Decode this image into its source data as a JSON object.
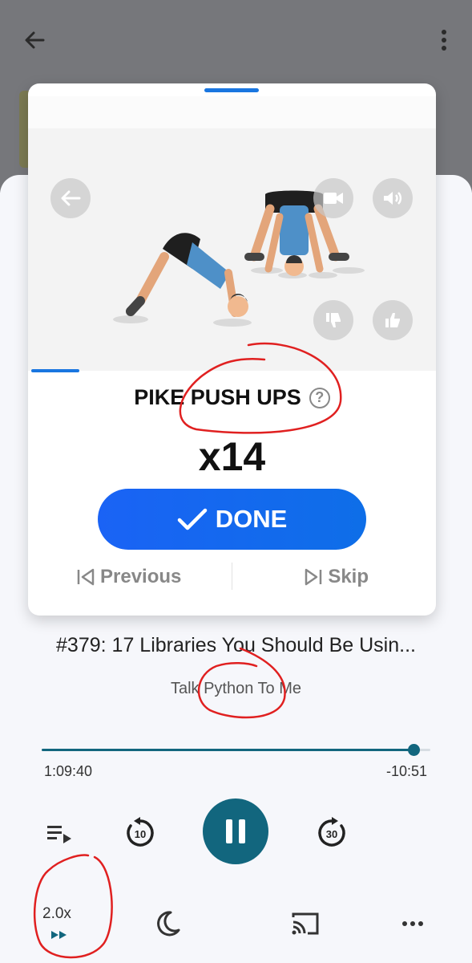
{
  "workout": {
    "exercise_name": "PIKE PUSH UPS",
    "help_glyph": "?",
    "reps": "x14",
    "done_label": "DONE",
    "previous_label": "Previous",
    "skip_label": "Skip",
    "accent_color": "#1976e0"
  },
  "player": {
    "episode_title": "#379: 17 Libraries You Should Be Usin...",
    "show_name": "Talk Python To Me",
    "progress_fraction": 0.956,
    "elapsed": "1:09:40",
    "remaining": "-10:51",
    "rewind_seconds": "10",
    "forward_seconds": "30",
    "speed": "2.0x",
    "accent_color": "#12667e"
  },
  "icons": {
    "back": "arrow-left-icon",
    "more": "more-vertical-icon",
    "queue": "playlist-icon",
    "sleep": "moon-icon",
    "cast": "cast-icon",
    "overflow": "more-horizontal-icon"
  }
}
